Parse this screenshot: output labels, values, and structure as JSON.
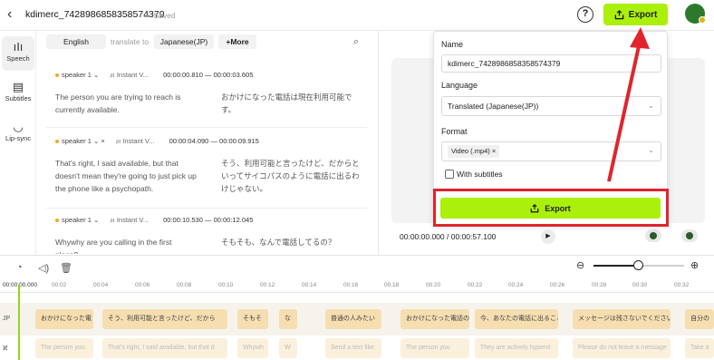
{
  "header": {
    "project_title": "kdimerc_7428986858358574379",
    "saved_label": "Saved",
    "help_icon": "?",
    "export_label": "Export"
  },
  "left_rail": {
    "items": [
      {
        "label": "Speech",
        "icon": "waveform-icon"
      },
      {
        "label": "Subtitles",
        "icon": "subtitles-icon"
      },
      {
        "label": "Lip-sync",
        "icon": "lip-sync-icon"
      }
    ]
  },
  "language_bar": {
    "source": "English",
    "translate_to": "translate to",
    "target": "Japanese(JP)",
    "more": "+More"
  },
  "segments": [
    {
      "speaker": "speaker 1",
      "voice": "Instant V...",
      "start": "00:00:00.810",
      "sep": "—",
      "end": "00:00:03.605",
      "en": "The person you are trying to reach is currently available.",
      "jp": "おかけになった電話は現在利用可能です。"
    },
    {
      "speaker": "speaker 1",
      "voice": "Instant V...",
      "start": "00:00:04.090",
      "sep": "—",
      "end": "00:00:09.915",
      "en": "That's right, I said available, but that doesn't mean they're going to just pick up the phone like a psychopath.",
      "jp": "そう、利用可能と言ったけど、だからといってサイコパスのように電話に出るわけじゃない。"
    },
    {
      "speaker": "speaker 1",
      "voice": "Instant V...",
      "start": "00:00:10.530",
      "sep": "—",
      "end": "00:00:12.045",
      "en": "Whywhy are you calling in the first place?",
      "jp": "そもそも、なんで電話してるの？"
    }
  ],
  "player": {
    "current_time": "00:00:00.000",
    "sep": "/",
    "duration": "00:00:57.100"
  },
  "export_dialog": {
    "name_label": "Name",
    "name_value": "kdimerc_7428986858358574379",
    "language_label": "Language",
    "language_value": "Translated (Japanese(JP))",
    "format_label": "Format",
    "format_chip": "Video (.mp4)",
    "format_chip_remove": "×",
    "subtitles_label": "With subtitles",
    "export_button": "Export"
  },
  "timeline": {
    "ruler": [
      "00:00:00.000",
      "00:02",
      "00:04",
      "00:06",
      "00:08",
      "00:10",
      "00:12",
      "00:14",
      "00:16",
      "00:18",
      "00:20",
      "00:22",
      "00:24",
      "00:26",
      "00:28",
      "00:30",
      "00:32"
    ],
    "track_jp_label": "JP",
    "jp_clips": [
      "おかけになった電",
      "そう、利用可能と言ったけど、だから",
      "そもそ",
      "な",
      "普通の人みたい",
      "おかけになった電話の",
      "今、あなたの電話に出ること",
      "メッセージは残さないでください",
      "自分の"
    ],
    "en_clips": [
      "The person you",
      "That's right, I said available, but that d",
      "Whywh",
      "W",
      "Send a text like",
      "The person you",
      "They are actively hypervi",
      "Please do not leave a message",
      "Take a"
    ]
  },
  "colors": {
    "accent_green": "#aaf00a",
    "highlight_red": "#e0242d",
    "jp_clip": "#f6deb0",
    "en_clip": "#fbf0db"
  }
}
